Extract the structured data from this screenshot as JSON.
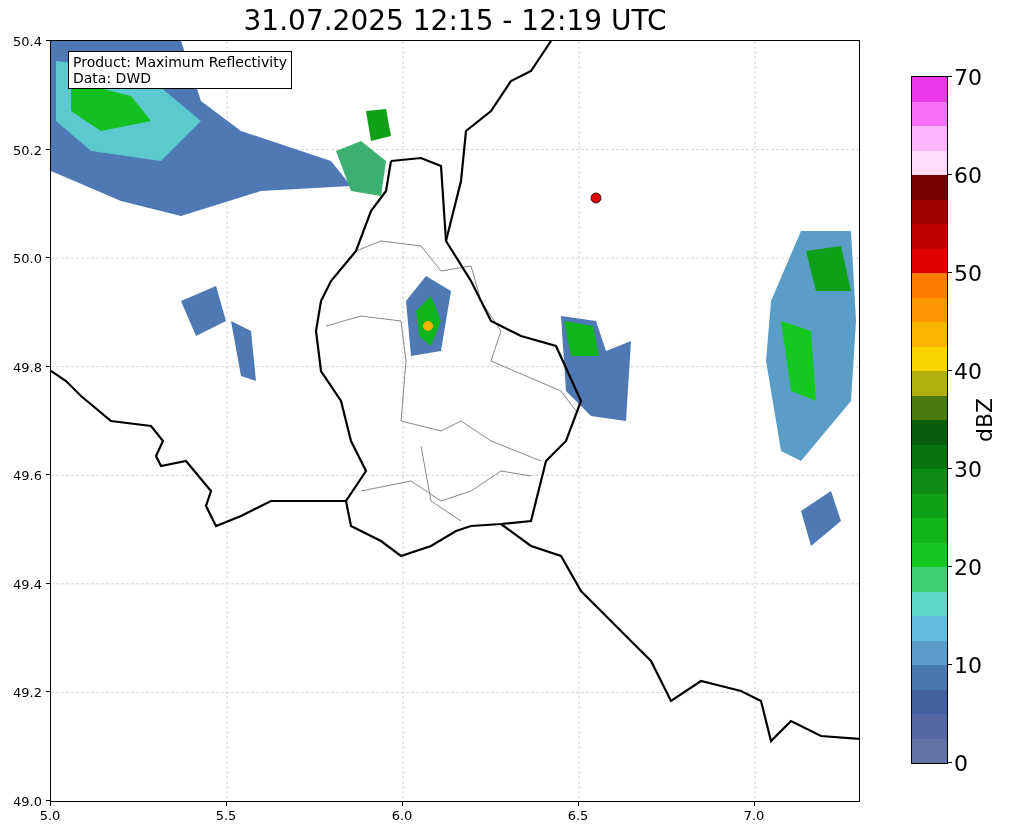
{
  "title": "31.07.2025 12:15 - 12:19 UTC",
  "annotation": [
    "Product: Maximum Reflectivity",
    "Data: DWD"
  ],
  "x_axis": {
    "ticks": [
      "5.0",
      "5.5",
      "6.0",
      "6.5",
      "7.0"
    ]
  },
  "y_axis": {
    "ticks": [
      "50.4",
      "50.2",
      "50.0",
      "49.8",
      "49.6",
      "49.4",
      "49.2",
      "49.0"
    ]
  },
  "colorbar": {
    "label": "dBZ",
    "ticks": [
      "70",
      "60",
      "50",
      "40",
      "30",
      "20",
      "10",
      "0"
    ],
    "segments": [
      {
        "color": "#6473a6"
      },
      {
        "color": "#5668a2"
      },
      {
        "color": "#4560a0"
      },
      {
        "color": "#4a78b0"
      },
      {
        "color": "#5c9cc8"
      },
      {
        "color": "#64bcdc"
      },
      {
        "color": "#60d8c8"
      },
      {
        "color": "#3cd070"
      },
      {
        "color": "#14c820"
      },
      {
        "color": "#10b41c"
      },
      {
        "color": "#10a018"
      },
      {
        "color": "#0c8c14"
      },
      {
        "color": "#0a7410"
      },
      {
        "color": "#085e0c"
      },
      {
        "color": "#4a7a10"
      },
      {
        "color": "#b0b00c"
      },
      {
        "color": "#fcd400"
      },
      {
        "color": "#fcb400"
      },
      {
        "color": "#fc9600"
      },
      {
        "color": "#fc7c00"
      },
      {
        "color": "#e00000"
      },
      {
        "color": "#c00000"
      },
      {
        "color": "#a00000"
      },
      {
        "color": "#780000"
      },
      {
        "color": "#ffdcfc"
      },
      {
        "color": "#ffb4fc"
      },
      {
        "color": "#f870f8"
      },
      {
        "color": "#ec38ec"
      }
    ]
  }
}
